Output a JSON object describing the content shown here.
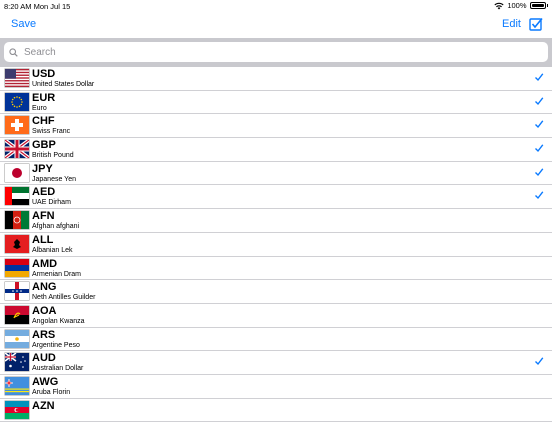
{
  "status": {
    "time": "8:20 AM",
    "date": "Mon Jul 15",
    "battery": "100%"
  },
  "nav": {
    "save_label": "Save",
    "edit_label": "Edit"
  },
  "search": {
    "placeholder": "Search"
  },
  "colors": {
    "accent": "#0a7aff",
    "search_bg": "#c9c9ce"
  },
  "currencies": [
    {
      "code": "USD",
      "name": "United States Dollar",
      "flag": "us-flag",
      "selected": true
    },
    {
      "code": "EUR",
      "name": "Euro",
      "flag": "eu-flag",
      "selected": true
    },
    {
      "code": "CHF",
      "name": "Swiss Franc",
      "flag": "ch-flag",
      "selected": true
    },
    {
      "code": "GBP",
      "name": "British Pound",
      "flag": "gb-flag",
      "selected": true
    },
    {
      "code": "JPY",
      "name": "Japanese Yen",
      "flag": "jp-flag",
      "selected": true
    },
    {
      "code": "AED",
      "name": "UAE Dirham",
      "flag": "ae-flag",
      "selected": true
    },
    {
      "code": "AFN",
      "name": "Afghan afghani",
      "flag": "af-flag",
      "selected": false
    },
    {
      "code": "ALL",
      "name": "Albanian Lek",
      "flag": "al-flag",
      "selected": false
    },
    {
      "code": "AMD",
      "name": "Armenian Dram",
      "flag": "am-flag",
      "selected": false
    },
    {
      "code": "ANG",
      "name": "Neth Antilles Guilder",
      "flag": "an-flag",
      "selected": false
    },
    {
      "code": "AOA",
      "name": "Angolan Kwanza",
      "flag": "ao-flag",
      "selected": false
    },
    {
      "code": "ARS",
      "name": "Argentine Peso",
      "flag": "ar-flag",
      "selected": false
    },
    {
      "code": "AUD",
      "name": "Australian Dollar",
      "flag": "au-flag",
      "selected": true
    },
    {
      "code": "AWG",
      "name": "Aruba Florin",
      "flag": "aw-flag",
      "selected": false
    },
    {
      "code": "AZN",
      "name": "",
      "flag": "az-flag",
      "selected": false
    }
  ]
}
